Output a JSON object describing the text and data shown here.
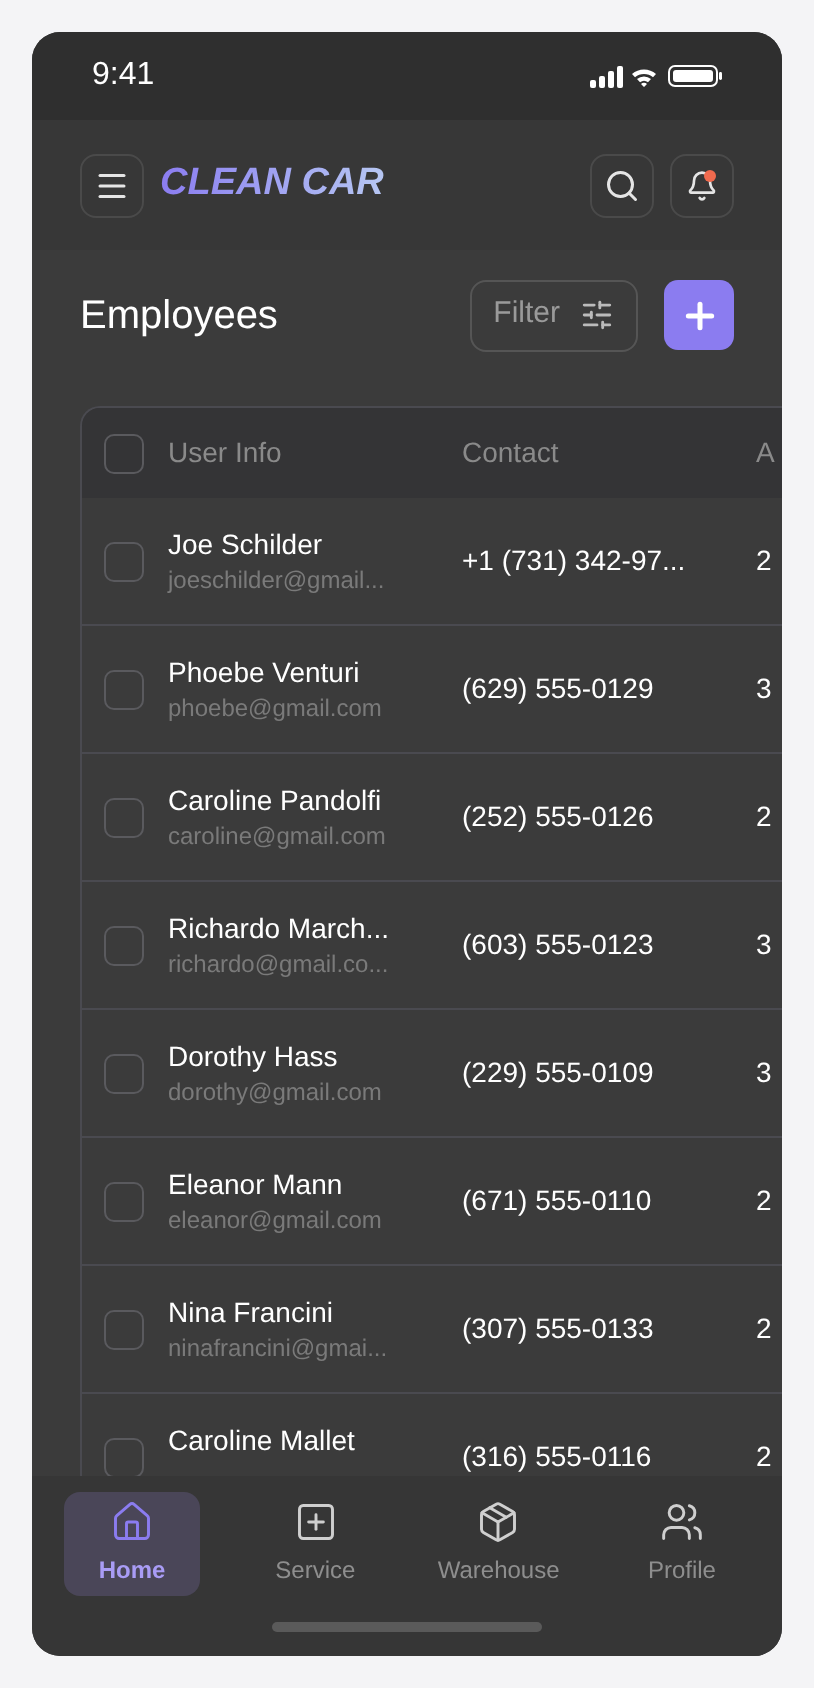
{
  "status_bar": {
    "time": "9:41"
  },
  "header": {
    "brand": "CLEAN CAR",
    "notification_dot": true
  },
  "page": {
    "title": "Employees",
    "filter_label": "Filter"
  },
  "table": {
    "select_all": {
      "checked": false
    },
    "columns": [
      "User Info",
      "Contact",
      "A"
    ],
    "rows": [
      {
        "name": "Joe Schilder",
        "email": "joeschilder@gmail...",
        "phone": "+1 (731) 342-97...",
        "column_3": "2",
        "checked": false
      },
      {
        "name": "Phoebe Venturi",
        "email": "phoebe@gmail.com",
        "phone": "(629) 555-0129",
        "column_3": "3",
        "checked": false
      },
      {
        "name": "Caroline Pandolfi",
        "email": "caroline@gmail.com",
        "phone": "(252) 555-0126",
        "column_3": "2",
        "checked": false
      },
      {
        "name": "Richardo March...",
        "email": "richardo@gmail.co...",
        "phone": "(603) 555-0123",
        "column_3": "3",
        "checked": false
      },
      {
        "name": "Dorothy Hass",
        "email": "dorothy@gmail.com",
        "phone": "(229) 555-0109",
        "column_3": "3",
        "checked": false
      },
      {
        "name": "Eleanor Mann",
        "email": "eleanor@gmail.com",
        "phone": "(671) 555-0110",
        "column_3": "2",
        "checked": false
      },
      {
        "name": "Nina Francini",
        "email": "ninafrancini@gmai...",
        "phone": "(307) 555-0133",
        "column_3": "2",
        "checked": false
      },
      {
        "name": "Caroline Mallet",
        "phone": "(316) 555-0116",
        "column_3": "2",
        "checked": false
      }
    ]
  },
  "tab_bar": [
    {
      "label": "Home",
      "kind": "home",
      "selected": true
    },
    {
      "label": "Service",
      "kind": "service",
      "selected": false
    },
    {
      "label": "Warehouse",
      "kind": "warehouse",
      "selected": false
    },
    {
      "label": "Profile",
      "kind": "profile",
      "selected": false
    }
  ]
}
